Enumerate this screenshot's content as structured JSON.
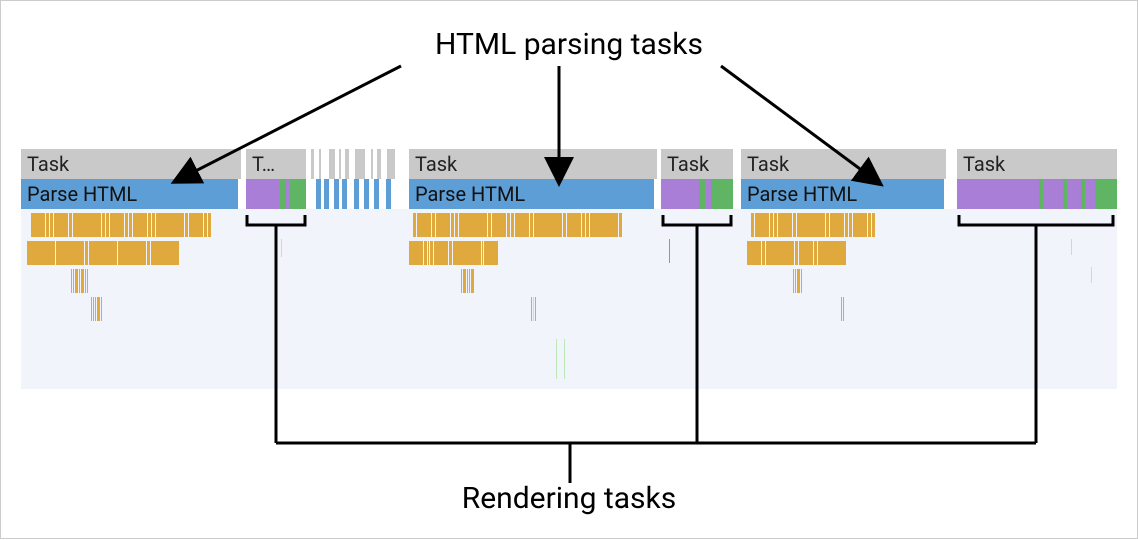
{
  "labels": {
    "top": "HTML parsing tasks",
    "bottom": "Rendering tasks"
  },
  "taskRow": {
    "full": "Task",
    "truncated": "T…"
  },
  "parseRow": {
    "label": "Parse HTML"
  },
  "colors": {
    "taskHeader": "#c9c9c9",
    "parseBlock": "#5e9ed6",
    "renderPurple": "#a87ed6",
    "renderGreen": "#5fb563",
    "detailOrange": "#e0a93e",
    "detailBg": "#f1f5fb"
  }
}
